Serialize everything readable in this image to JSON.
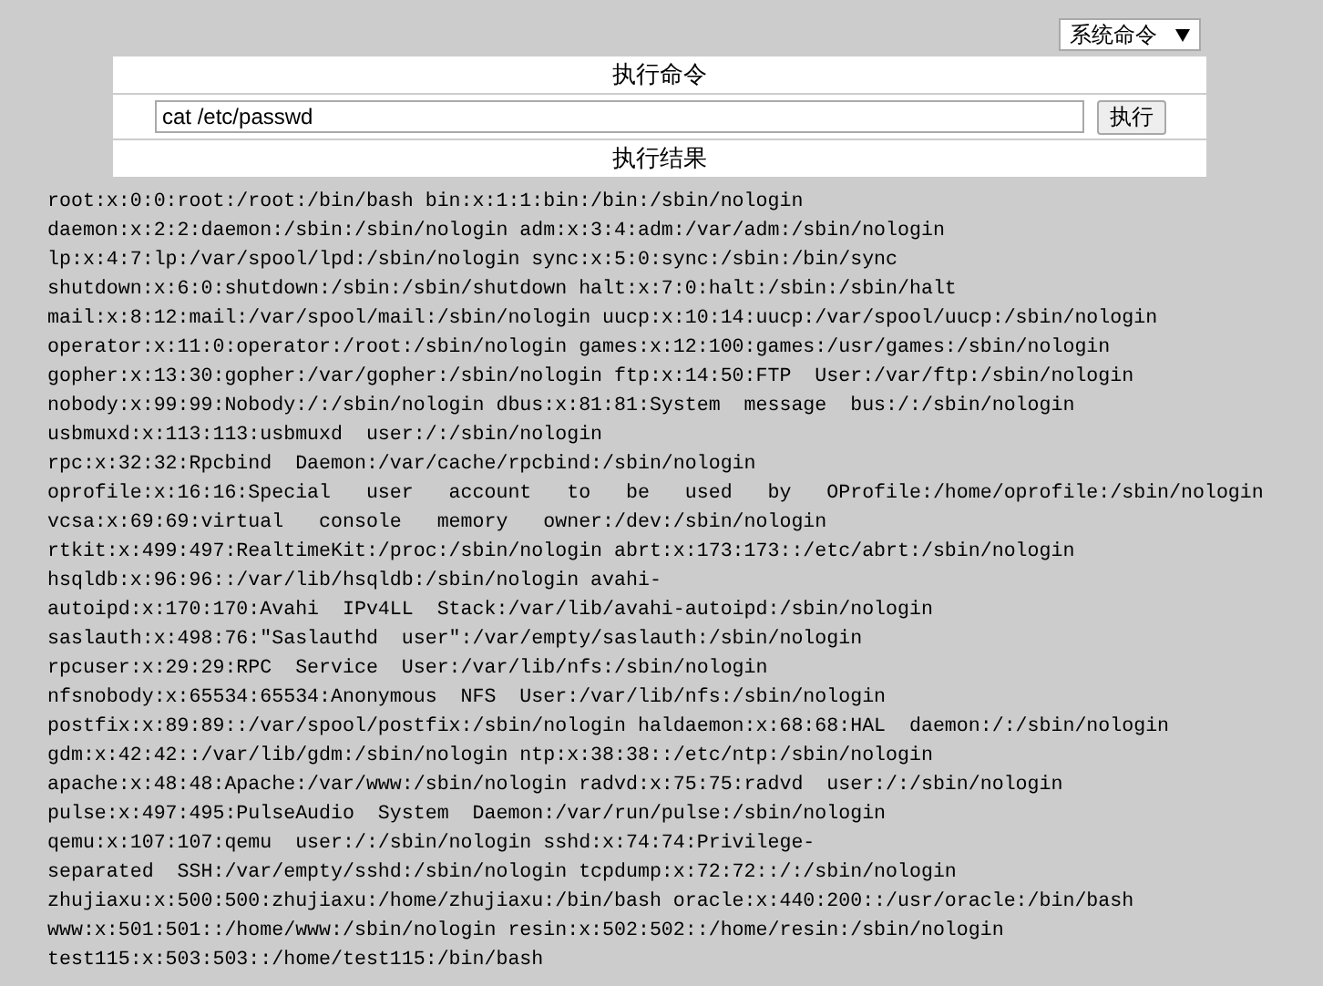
{
  "mode_select": {
    "value": "系统命令"
  },
  "command_title": "执行命令",
  "command_input": {
    "value": "cat /etc/passwd"
  },
  "run_button": "执行",
  "result_title": "执行结果",
  "output_lines": [
    "root:x:0:0:root:/root:/bin/bash bin:x:1:1:bin:/bin:/sbin/nologin",
    "daemon:x:2:2:daemon:/sbin:/sbin/nologin adm:x:3:4:adm:/var/adm:/sbin/nologin",
    "lp:x:4:7:lp:/var/spool/lpd:/sbin/nologin sync:x:5:0:sync:/sbin:/bin/sync",
    "shutdown:x:6:0:shutdown:/sbin:/sbin/shutdown halt:x:7:0:halt:/sbin:/sbin/halt",
    "mail:x:8:12:mail:/var/spool/mail:/sbin/nologin uucp:x:10:14:uucp:/var/spool/uucp:/sbin/nologin",
    "operator:x:11:0:operator:/root:/sbin/nologin games:x:12:100:games:/usr/games:/sbin/nologin",
    "gopher:x:13:30:gopher:/var/gopher:/sbin/nologin ftp:x:14:50:FTP  User:/var/ftp:/sbin/nologin",
    "nobody:x:99:99:Nobody:/:/sbin/nologin dbus:x:81:81:System  message  bus:/:/sbin/nologin",
    "usbmuxd:x:113:113:usbmuxd  user:/:/sbin/nologin",
    "rpc:x:32:32:Rpcbind  Daemon:/var/cache/rpcbind:/sbin/nologin",
    "oprofile:x:16:16:Special   user   account   to   be   used   by   OProfile:/home/oprofile:/sbin/nologin",
    "vcsa:x:69:69:virtual   console   memory   owner:/dev:/sbin/nologin",
    "rtkit:x:499:497:RealtimeKit:/proc:/sbin/nologin abrt:x:173:173::/etc/abrt:/sbin/nologin",
    "hsqldb:x:96:96::/var/lib/hsqldb:/sbin/nologin avahi-",
    "autoipd:x:170:170:Avahi  IPv4LL  Stack:/var/lib/avahi-autoipd:/sbin/nologin",
    "saslauth:x:498:76:\"Saslauthd  user\":/var/empty/saslauth:/sbin/nologin",
    "rpcuser:x:29:29:RPC  Service  User:/var/lib/nfs:/sbin/nologin",
    "nfsnobody:x:65534:65534:Anonymous  NFS  User:/var/lib/nfs:/sbin/nologin",
    "postfix:x:89:89::/var/spool/postfix:/sbin/nologin haldaemon:x:68:68:HAL  daemon:/:/sbin/nologin",
    "gdm:x:42:42::/var/lib/gdm:/sbin/nologin ntp:x:38:38::/etc/ntp:/sbin/nologin",
    "apache:x:48:48:Apache:/var/www:/sbin/nologin radvd:x:75:75:radvd  user:/:/sbin/nologin",
    "pulse:x:497:495:PulseAudio  System  Daemon:/var/run/pulse:/sbin/nologin",
    "qemu:x:107:107:qemu  user:/:/sbin/nologin sshd:x:74:74:Privilege-",
    "separated  SSH:/var/empty/sshd:/sbin/nologin tcpdump:x:72:72::/:/sbin/nologin",
    "zhujiaxu:x:500:500:zhujiaxu:/home/zhujiaxu:/bin/bash oracle:x:440:200::/usr/oracle:/bin/bash",
    "www:x:501:501::/home/www:/sbin/nologin resin:x:502:502::/home/resin:/sbin/nologin",
    "test115:x:503:503::/home/test115:/bin/bash"
  ]
}
